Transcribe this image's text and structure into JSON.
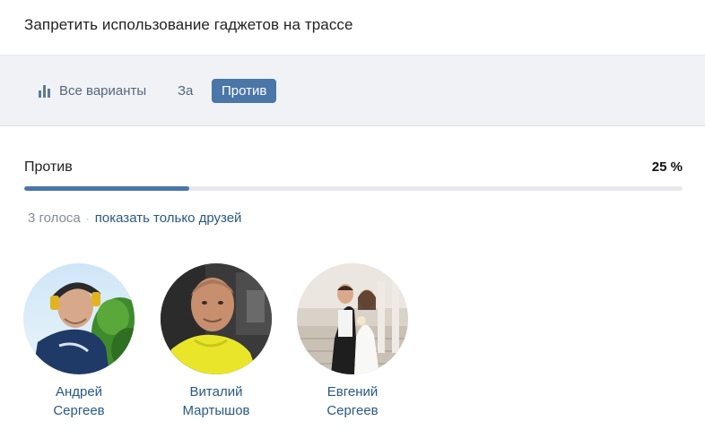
{
  "poll": {
    "title": "Запретить использование гаджетов на трассе"
  },
  "tabs": {
    "all": "Все варианты",
    "for": "За",
    "against": "Против",
    "active": "against"
  },
  "result": {
    "label": "Против",
    "percent_text": "25 %",
    "percent_value": 25
  },
  "votes": {
    "count_text": "3 голоса",
    "separator": "·",
    "friends_link": "показать только друзей"
  },
  "voters": [
    {
      "first_name": "Андрей",
      "last_name": "Сергеев"
    },
    {
      "first_name": "Виталий",
      "last_name": "Мартышов"
    },
    {
      "first_name": "Евгений",
      "last_name": "Сергеев"
    }
  ],
  "colors": {
    "accent": "#4a76a8",
    "link": "#2a5885",
    "muted": "#818c99",
    "tabs_background": "#f0f2f5"
  }
}
